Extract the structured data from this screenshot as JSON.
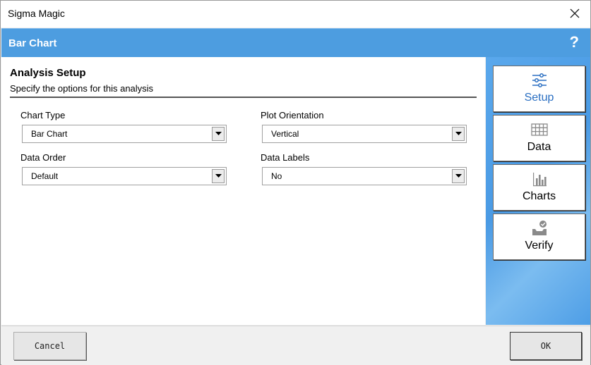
{
  "window": {
    "title": "Sigma Magic"
  },
  "banner": {
    "title": "Bar Chart",
    "help": "?"
  },
  "setup": {
    "title": "Analysis Setup",
    "subtitle": "Specify the options for this analysis",
    "fields": {
      "chart_type": {
        "label": "Chart Type",
        "value": "Bar Chart"
      },
      "plot_orientation": {
        "label": "Plot Orientation",
        "value": "Vertical"
      },
      "data_order": {
        "label": "Data Order",
        "value": "Default"
      },
      "data_labels": {
        "label": "Data Labels",
        "value": "No"
      }
    }
  },
  "nav": {
    "items": [
      {
        "label": "Setup",
        "icon": "sliders-icon",
        "active": true
      },
      {
        "label": "Data",
        "icon": "grid-icon",
        "active": false
      },
      {
        "label": "Charts",
        "icon": "bar-chart-icon",
        "active": false
      },
      {
        "label": "Verify",
        "icon": "verify-tray-icon",
        "active": false
      }
    ]
  },
  "footer": {
    "cancel": "Cancel",
    "ok": "OK"
  },
  "colors": {
    "banner": "#4d9de0",
    "active_nav": "#2a6fc2",
    "panel": "#5aa8ec"
  }
}
